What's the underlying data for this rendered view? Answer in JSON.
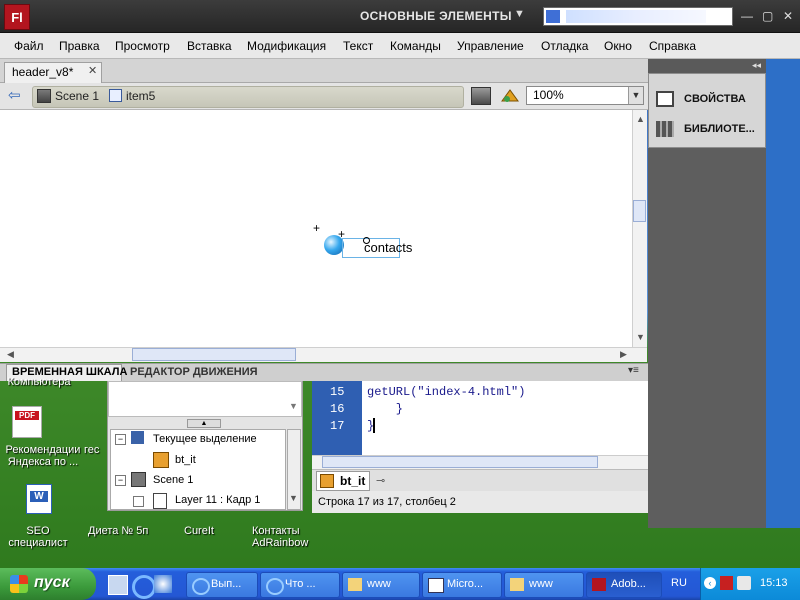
{
  "app": {
    "logo": "Fl",
    "workspace": "ОСНОВНЫЕ ЭЛЕМЕНТЫ",
    "menu": [
      "Файл",
      "Правка",
      "Просмотр",
      "Вставка",
      "Модификация",
      "Текст",
      "Команды",
      "Управление",
      "Отладка",
      "Окно",
      "Справка"
    ]
  },
  "document": {
    "tab": "header_v8*",
    "breadcrumb": {
      "scene": "Scene 1",
      "item": "item5"
    },
    "zoom": "100%"
  },
  "stage": {
    "text": "contacts"
  },
  "panels": {
    "right": {
      "properties": "СВОЙСТВА",
      "library": "БИБЛИОТЕ..."
    },
    "bottom_tabs": [
      "ВРЕМЕННАЯ ШКАЛА",
      "РЕДАКТОР ДВИЖЕНИЯ"
    ],
    "tree": {
      "current_selection": "Текущее выделение",
      "bt_it": "bt_it",
      "scene": "Scene 1",
      "layer": "Layer 11 : Кадр 1"
    },
    "code": {
      "lines": [
        {
          "num": "15",
          "text": "getURL(\"index-4.html\")"
        },
        {
          "num": "16",
          "text": "    }"
        },
        {
          "num": "17",
          "text": "}"
        }
      ]
    },
    "script_tab": "bt_it",
    "status": "Строка 17 из 17, столбец 2"
  },
  "desktop": {
    "labels": {
      "komp": "Компьютера",
      "rekom": "Рекомендации\nЯндекса по ...",
      "ges": "гес",
      "seo": "SEO\nспециалист",
      "dieta": "Диета № 5п",
      "cureit": "CureIt",
      "kontakty": "Контакты\nAdRainbow"
    }
  },
  "taskbar": {
    "start": "пуск",
    "tasks": [
      "Вып...",
      "Что ...",
      "www",
      "Micro...",
      "www",
      "Adob..."
    ],
    "lang": "RU",
    "clock": "15:13"
  }
}
